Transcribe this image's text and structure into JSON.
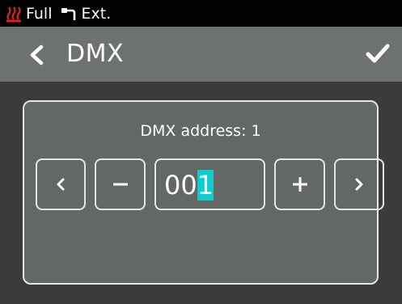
{
  "status_bar": {
    "mode_label": "Full",
    "output_label": "Ext.",
    "icons": [
      "heat-icon",
      "cable-icon"
    ],
    "heat_icon_color": "#e0251b"
  },
  "header": {
    "title": "DMX",
    "icons": [
      "chevron-left-icon",
      "checkmark-icon"
    ]
  },
  "address": {
    "label": "DMX address: 1",
    "value_digits": [
      "0",
      "0",
      "1"
    ],
    "cursor_index": 2,
    "cursor_color": "#12c9cc"
  },
  "controls": {
    "icons": [
      "chevron-left-icon",
      "minus-icon",
      "plus-icon",
      "chevron-right-icon"
    ]
  },
  "colors": {
    "status_bar_bg": "#000000",
    "header_bg": "#6f7370",
    "screen_bg": "#3a3b3d",
    "panel_bg": "#636864",
    "border": "#e4e6e3"
  }
}
